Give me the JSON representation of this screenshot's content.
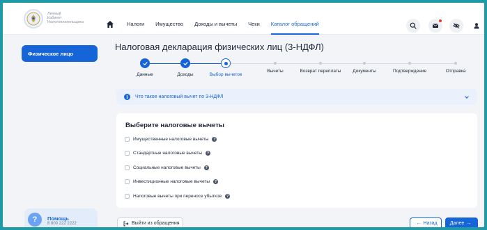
{
  "brand": {
    "line1": "Личный",
    "line2": "Кабинет",
    "line3": "Налогоплательщика"
  },
  "nav": {
    "items": [
      {
        "label": "Налоги",
        "active": false
      },
      {
        "label": "Имущество",
        "active": false
      },
      {
        "label": "Доходы и вычеты",
        "active": false
      },
      {
        "label": "Чеки",
        "active": false
      },
      {
        "label": "Каталог обращений",
        "active": true
      }
    ]
  },
  "header_icons": [
    "search-icon",
    "mail-icon",
    "eye-off-icon",
    "user-icon"
  ],
  "sidebar": {
    "active_label": "Физическое лицо"
  },
  "help": {
    "title": "Помощь",
    "phone": "8 800 222 2222",
    "icon": "?"
  },
  "page": {
    "title": "Налоговая декларация физических лиц (3-НДФЛ)"
  },
  "stepper": {
    "current_index": 2,
    "steps": [
      {
        "label": "Данные",
        "state": "done"
      },
      {
        "label": "Доходы",
        "state": "done"
      },
      {
        "label": "Выбор вычетов",
        "state": "current"
      },
      {
        "label": "Вычеты",
        "state": "todo"
      },
      {
        "label": "Возврат переплаты",
        "state": "todo"
      },
      {
        "label": "Документы",
        "state": "todo"
      },
      {
        "label": "Подтверждение",
        "state": "todo"
      },
      {
        "label": "Отправка",
        "state": "todo"
      }
    ]
  },
  "info": {
    "icon": "i",
    "text": "Что такое налоговый вычет по 3-НДФЛ"
  },
  "deductions": {
    "title": "Выберите налоговые вычеты",
    "help_glyph": "?",
    "options": [
      {
        "label": "Имущественные налоговые вычеты",
        "checked": false
      },
      {
        "label": "Стандартные налоговые вычеты",
        "checked": false
      },
      {
        "label": "Социальные налоговые вычеты",
        "checked": false
      },
      {
        "label": "Инвестиционные налоговые вычеты",
        "checked": false
      },
      {
        "label": "Налоговые вычеты при переносе убытков",
        "checked": false
      }
    ]
  },
  "footer": {
    "exit_label": "Выйти из обращения",
    "back_label": "Назад",
    "next_label": "Далее"
  },
  "colors": {
    "accent": "#1665d8",
    "background": "#f2f4f7",
    "frame": "#1f9aa6",
    "notification": "#e53935"
  }
}
